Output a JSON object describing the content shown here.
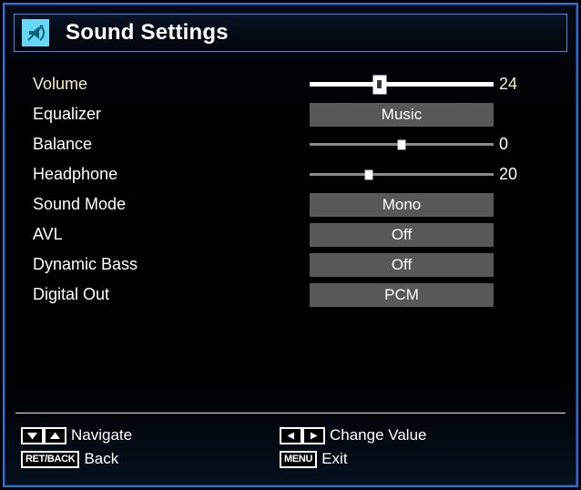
{
  "window": {
    "title": "Sound Settings",
    "title_icon": "sound-settings-icon",
    "frame_color": "#2f6fd8",
    "title_border_color": "#4d86e0",
    "icon_bg_color": "#67d9f5"
  },
  "colors": {
    "selected_text": "#f5edc8",
    "normal_text": "#ffffff",
    "option_box_bg": "#585858",
    "slider_track": "#8a8a8a",
    "slider_track_selected": "#ffffff",
    "background": "#000000"
  },
  "settings": [
    {
      "label": "Volume",
      "control": "slider",
      "value": "24",
      "percent": 38,
      "selected": true
    },
    {
      "label": "Equalizer",
      "control": "option",
      "value": "Music",
      "selected": false
    },
    {
      "label": "Balance",
      "control": "slider",
      "value": "0",
      "percent": 50,
      "selected": false
    },
    {
      "label": "Headphone",
      "control": "slider",
      "value": "20",
      "percent": 32,
      "selected": false
    },
    {
      "label": "Sound Mode",
      "control": "option",
      "value": "Mono",
      "selected": false
    },
    {
      "label": "AVL",
      "control": "option",
      "value": "Off",
      "selected": false
    },
    {
      "label": "Dynamic Bass",
      "control": "option",
      "value": "Off",
      "selected": false
    },
    {
      "label": "Digital Out",
      "control": "option",
      "value": "PCM",
      "selected": false
    }
  ],
  "help": {
    "left": [
      {
        "keys": [
          "down-arrow-icon",
          "up-arrow-icon"
        ],
        "key_labels": [
          "",
          ""
        ],
        "text": "Navigate"
      },
      {
        "keys": [
          "ret-back-key"
        ],
        "key_labels": [
          "RET/BACK"
        ],
        "text": "Back"
      }
    ],
    "right": [
      {
        "keys": [
          "left-arrow-icon",
          "right-arrow-icon"
        ],
        "key_labels": [
          "",
          ""
        ],
        "text": "Change Value"
      },
      {
        "keys": [
          "menu-key"
        ],
        "key_labels": [
          "MENU"
        ],
        "text": "Exit"
      }
    ]
  }
}
